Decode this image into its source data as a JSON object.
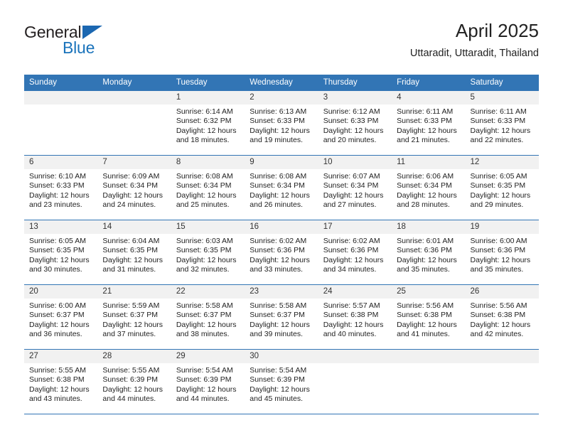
{
  "brand": {
    "name_part1": "General",
    "name_part2": "Blue",
    "triangle_color": "#1b67b1",
    "blue_color": "#1a73bb"
  },
  "header": {
    "title": "April 2025",
    "subtitle": "Uttaradit, Uttaradit, Thailand"
  },
  "theme": {
    "header_bg": "#3275b5",
    "daynum_bg": "#f1f1f1",
    "row_rule": "#3275b5"
  },
  "calendar": {
    "weekday_headers": [
      "Sunday",
      "Monday",
      "Tuesday",
      "Wednesday",
      "Thursday",
      "Friday",
      "Saturday"
    ],
    "weeks": [
      [
        {
          "day": "",
          "sunrise": "",
          "sunset": "",
          "daylight_line1": "",
          "daylight_line2": ""
        },
        {
          "day": "",
          "sunrise": "",
          "sunset": "",
          "daylight_line1": "",
          "daylight_line2": ""
        },
        {
          "day": "1",
          "sunrise": "Sunrise: 6:14 AM",
          "sunset": "Sunset: 6:32 PM",
          "daylight_line1": "Daylight: 12 hours",
          "daylight_line2": "and 18 minutes."
        },
        {
          "day": "2",
          "sunrise": "Sunrise: 6:13 AM",
          "sunset": "Sunset: 6:33 PM",
          "daylight_line1": "Daylight: 12 hours",
          "daylight_line2": "and 19 minutes."
        },
        {
          "day": "3",
          "sunrise": "Sunrise: 6:12 AM",
          "sunset": "Sunset: 6:33 PM",
          "daylight_line1": "Daylight: 12 hours",
          "daylight_line2": "and 20 minutes."
        },
        {
          "day": "4",
          "sunrise": "Sunrise: 6:11 AM",
          "sunset": "Sunset: 6:33 PM",
          "daylight_line1": "Daylight: 12 hours",
          "daylight_line2": "and 21 minutes."
        },
        {
          "day": "5",
          "sunrise": "Sunrise: 6:11 AM",
          "sunset": "Sunset: 6:33 PM",
          "daylight_line1": "Daylight: 12 hours",
          "daylight_line2": "and 22 minutes."
        }
      ],
      [
        {
          "day": "6",
          "sunrise": "Sunrise: 6:10 AM",
          "sunset": "Sunset: 6:33 PM",
          "daylight_line1": "Daylight: 12 hours",
          "daylight_line2": "and 23 minutes."
        },
        {
          "day": "7",
          "sunrise": "Sunrise: 6:09 AM",
          "sunset": "Sunset: 6:34 PM",
          "daylight_line1": "Daylight: 12 hours",
          "daylight_line2": "and 24 minutes."
        },
        {
          "day": "8",
          "sunrise": "Sunrise: 6:08 AM",
          "sunset": "Sunset: 6:34 PM",
          "daylight_line1": "Daylight: 12 hours",
          "daylight_line2": "and 25 minutes."
        },
        {
          "day": "9",
          "sunrise": "Sunrise: 6:08 AM",
          "sunset": "Sunset: 6:34 PM",
          "daylight_line1": "Daylight: 12 hours",
          "daylight_line2": "and 26 minutes."
        },
        {
          "day": "10",
          "sunrise": "Sunrise: 6:07 AM",
          "sunset": "Sunset: 6:34 PM",
          "daylight_line1": "Daylight: 12 hours",
          "daylight_line2": "and 27 minutes."
        },
        {
          "day": "11",
          "sunrise": "Sunrise: 6:06 AM",
          "sunset": "Sunset: 6:34 PM",
          "daylight_line1": "Daylight: 12 hours",
          "daylight_line2": "and 28 minutes."
        },
        {
          "day": "12",
          "sunrise": "Sunrise: 6:05 AM",
          "sunset": "Sunset: 6:35 PM",
          "daylight_line1": "Daylight: 12 hours",
          "daylight_line2": "and 29 minutes."
        }
      ],
      [
        {
          "day": "13",
          "sunrise": "Sunrise: 6:05 AM",
          "sunset": "Sunset: 6:35 PM",
          "daylight_line1": "Daylight: 12 hours",
          "daylight_line2": "and 30 minutes."
        },
        {
          "day": "14",
          "sunrise": "Sunrise: 6:04 AM",
          "sunset": "Sunset: 6:35 PM",
          "daylight_line1": "Daylight: 12 hours",
          "daylight_line2": "and 31 minutes."
        },
        {
          "day": "15",
          "sunrise": "Sunrise: 6:03 AM",
          "sunset": "Sunset: 6:35 PM",
          "daylight_line1": "Daylight: 12 hours",
          "daylight_line2": "and 32 minutes."
        },
        {
          "day": "16",
          "sunrise": "Sunrise: 6:02 AM",
          "sunset": "Sunset: 6:36 PM",
          "daylight_line1": "Daylight: 12 hours",
          "daylight_line2": "and 33 minutes."
        },
        {
          "day": "17",
          "sunrise": "Sunrise: 6:02 AM",
          "sunset": "Sunset: 6:36 PM",
          "daylight_line1": "Daylight: 12 hours",
          "daylight_line2": "and 34 minutes."
        },
        {
          "day": "18",
          "sunrise": "Sunrise: 6:01 AM",
          "sunset": "Sunset: 6:36 PM",
          "daylight_line1": "Daylight: 12 hours",
          "daylight_line2": "and 35 minutes."
        },
        {
          "day": "19",
          "sunrise": "Sunrise: 6:00 AM",
          "sunset": "Sunset: 6:36 PM",
          "daylight_line1": "Daylight: 12 hours",
          "daylight_line2": "and 35 minutes."
        }
      ],
      [
        {
          "day": "20",
          "sunrise": "Sunrise: 6:00 AM",
          "sunset": "Sunset: 6:37 PM",
          "daylight_line1": "Daylight: 12 hours",
          "daylight_line2": "and 36 minutes."
        },
        {
          "day": "21",
          "sunrise": "Sunrise: 5:59 AM",
          "sunset": "Sunset: 6:37 PM",
          "daylight_line1": "Daylight: 12 hours",
          "daylight_line2": "and 37 minutes."
        },
        {
          "day": "22",
          "sunrise": "Sunrise: 5:58 AM",
          "sunset": "Sunset: 6:37 PM",
          "daylight_line1": "Daylight: 12 hours",
          "daylight_line2": "and 38 minutes."
        },
        {
          "day": "23",
          "sunrise": "Sunrise: 5:58 AM",
          "sunset": "Sunset: 6:37 PM",
          "daylight_line1": "Daylight: 12 hours",
          "daylight_line2": "and 39 minutes."
        },
        {
          "day": "24",
          "sunrise": "Sunrise: 5:57 AM",
          "sunset": "Sunset: 6:38 PM",
          "daylight_line1": "Daylight: 12 hours",
          "daylight_line2": "and 40 minutes."
        },
        {
          "day": "25",
          "sunrise": "Sunrise: 5:56 AM",
          "sunset": "Sunset: 6:38 PM",
          "daylight_line1": "Daylight: 12 hours",
          "daylight_line2": "and 41 minutes."
        },
        {
          "day": "26",
          "sunrise": "Sunrise: 5:56 AM",
          "sunset": "Sunset: 6:38 PM",
          "daylight_line1": "Daylight: 12 hours",
          "daylight_line2": "and 42 minutes."
        }
      ],
      [
        {
          "day": "27",
          "sunrise": "Sunrise: 5:55 AM",
          "sunset": "Sunset: 6:38 PM",
          "daylight_line1": "Daylight: 12 hours",
          "daylight_line2": "and 43 minutes."
        },
        {
          "day": "28",
          "sunrise": "Sunrise: 5:55 AM",
          "sunset": "Sunset: 6:39 PM",
          "daylight_line1": "Daylight: 12 hours",
          "daylight_line2": "and 44 minutes."
        },
        {
          "day": "29",
          "sunrise": "Sunrise: 5:54 AM",
          "sunset": "Sunset: 6:39 PM",
          "daylight_line1": "Daylight: 12 hours",
          "daylight_line2": "and 44 minutes."
        },
        {
          "day": "30",
          "sunrise": "Sunrise: 5:54 AM",
          "sunset": "Sunset: 6:39 PM",
          "daylight_line1": "Daylight: 12 hours",
          "daylight_line2": "and 45 minutes."
        },
        {
          "day": "",
          "sunrise": "",
          "sunset": "",
          "daylight_line1": "",
          "daylight_line2": ""
        },
        {
          "day": "",
          "sunrise": "",
          "sunset": "",
          "daylight_line1": "",
          "daylight_line2": ""
        },
        {
          "day": "",
          "sunrise": "",
          "sunset": "",
          "daylight_line1": "",
          "daylight_line2": ""
        }
      ]
    ]
  }
}
